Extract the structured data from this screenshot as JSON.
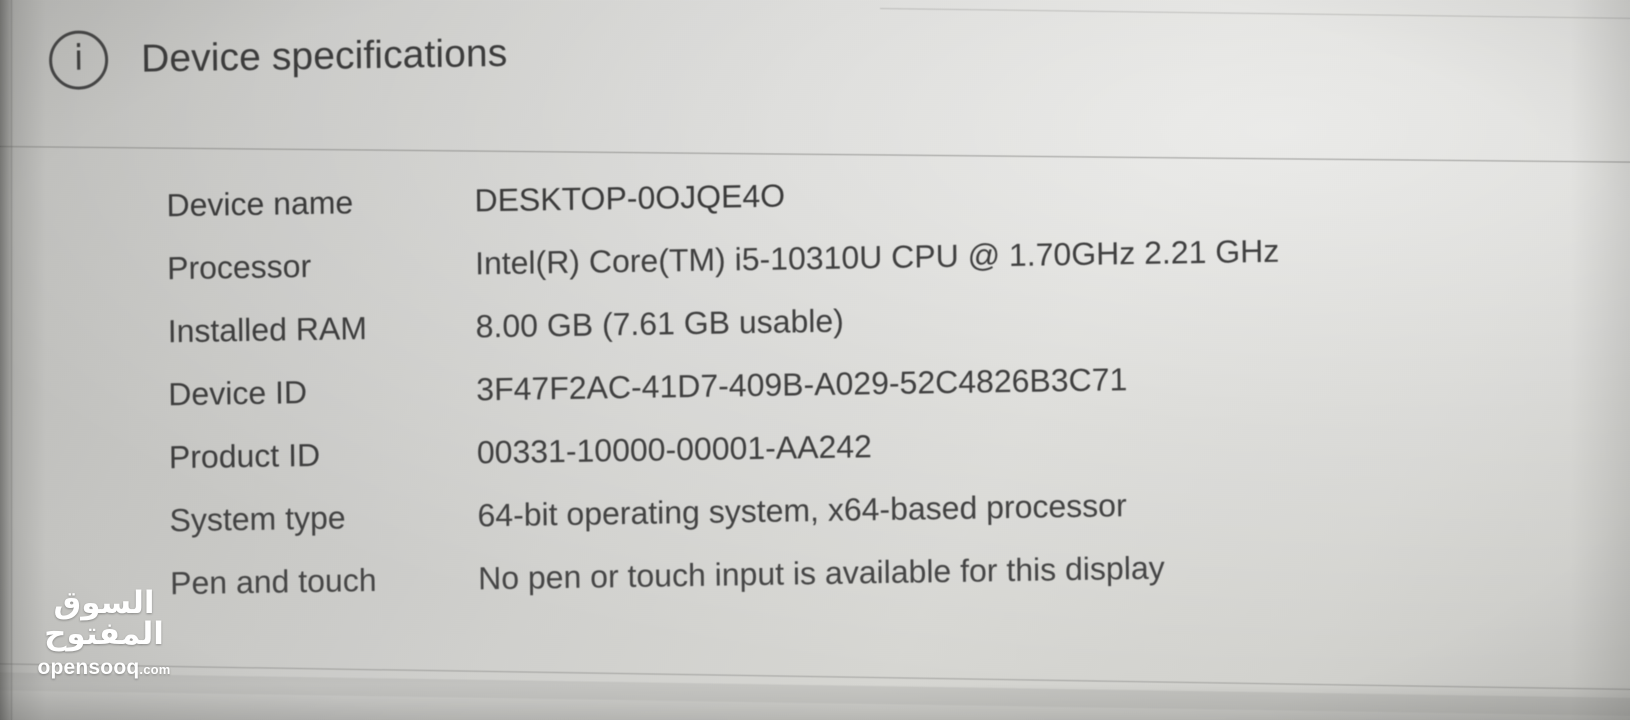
{
  "header": {
    "icon": "info-circle-icon",
    "icon_glyph": "i",
    "title": "Device specifications"
  },
  "specs": [
    {
      "label": "Device name",
      "value": "DESKTOP-0OJQE4O"
    },
    {
      "label": "Processor",
      "value": "Intel(R) Core(TM) i5-10310U CPU @ 1.70GHz   2.21 GHz"
    },
    {
      "label": "Installed RAM",
      "value": "8.00 GB (7.61 GB usable)"
    },
    {
      "label": "Device ID",
      "value": "3F47F2AC-41D7-409B-A029-52C4826B3C71"
    },
    {
      "label": "Product ID",
      "value": "00331-10000-00001-AA242"
    },
    {
      "label": "System type",
      "value": "64-bit operating system, x64-based processor"
    },
    {
      "label": "Pen and touch",
      "value": "No pen or touch input is available for this display"
    }
  ],
  "watermark": {
    "arabic": "السوق المفتوح",
    "latin": "opensooq",
    "tld": ".com"
  },
  "colors": {
    "background": "#d2d2cf",
    "text": "#3d3d3d",
    "divider": "#808080",
    "watermark": "#ffffff"
  }
}
